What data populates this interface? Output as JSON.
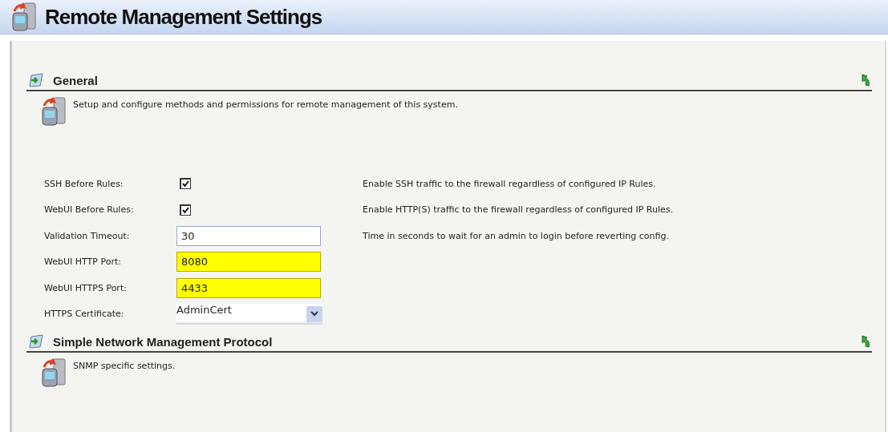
{
  "page": {
    "title": "Remote Management Settings"
  },
  "sections": [
    {
      "title": "General",
      "description": "Setup and configure methods and permissions for remote management of this system.",
      "fields": [
        {
          "kind": "checkbox",
          "label": "SSH Before Rules:",
          "checked": true,
          "help": "Enable SSH traffic to the firewall regardless of configured IP Rules."
        },
        {
          "kind": "checkbox",
          "label": "WebUI Before Rules:",
          "checked": true,
          "help": "Enable HTTP(S) traffic to the firewall regardless of configured IP Rules."
        },
        {
          "kind": "text",
          "label": "Validation Timeout:",
          "value": "30",
          "highlighted": false,
          "help": "Time in seconds to wait for an admin to login before reverting config."
        },
        {
          "kind": "text",
          "label": "WebUI HTTP Port:",
          "value": "8080",
          "highlighted": true
        },
        {
          "kind": "text",
          "label": "WebUI HTTPS Port:",
          "value": "4433",
          "highlighted": true
        },
        {
          "kind": "select",
          "label": "HTTPS Certificate:",
          "value": "AdminCert"
        }
      ]
    },
    {
      "title": "Simple Network Management Protocol",
      "description": "SNMP specific settings."
    }
  ]
}
